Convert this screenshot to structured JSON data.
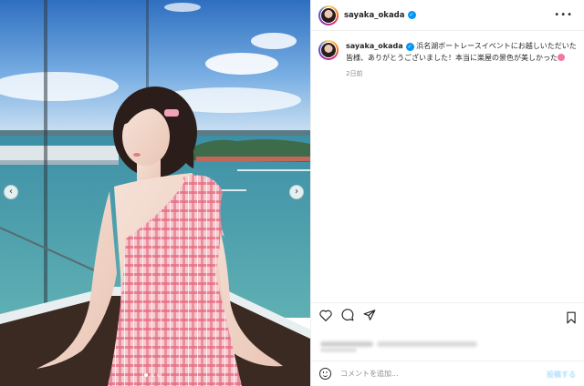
{
  "post": {
    "image_alt": "Woman in pink plaid one-shoulder dress posing by a window overlooking a lake",
    "carousel": {
      "prev_icon": "‹",
      "next_icon": "›",
      "dot_count": 3,
      "active_dot": 0
    }
  },
  "header": {
    "username": "sayaka_okada",
    "verified": true,
    "more_icon": "•••"
  },
  "caption": {
    "username": "sayaka_okada",
    "text": "浜名湖ボートレースイベントにお越しいただいた皆様、ありがとうございました！本当に楽屋の景色が美しかった",
    "time": "2日前"
  },
  "actions": {
    "like_icon": "heart-icon",
    "comment_icon": "comment-icon",
    "share_icon": "share-icon",
    "save_icon": "bookmark-icon"
  },
  "comment": {
    "placeholder": "コメントを追加...",
    "post_label": "投稿する"
  },
  "colors": {
    "accent": "#0095f6",
    "border": "#efefef",
    "muted": "#8e8e8e",
    "text": "#262626"
  }
}
